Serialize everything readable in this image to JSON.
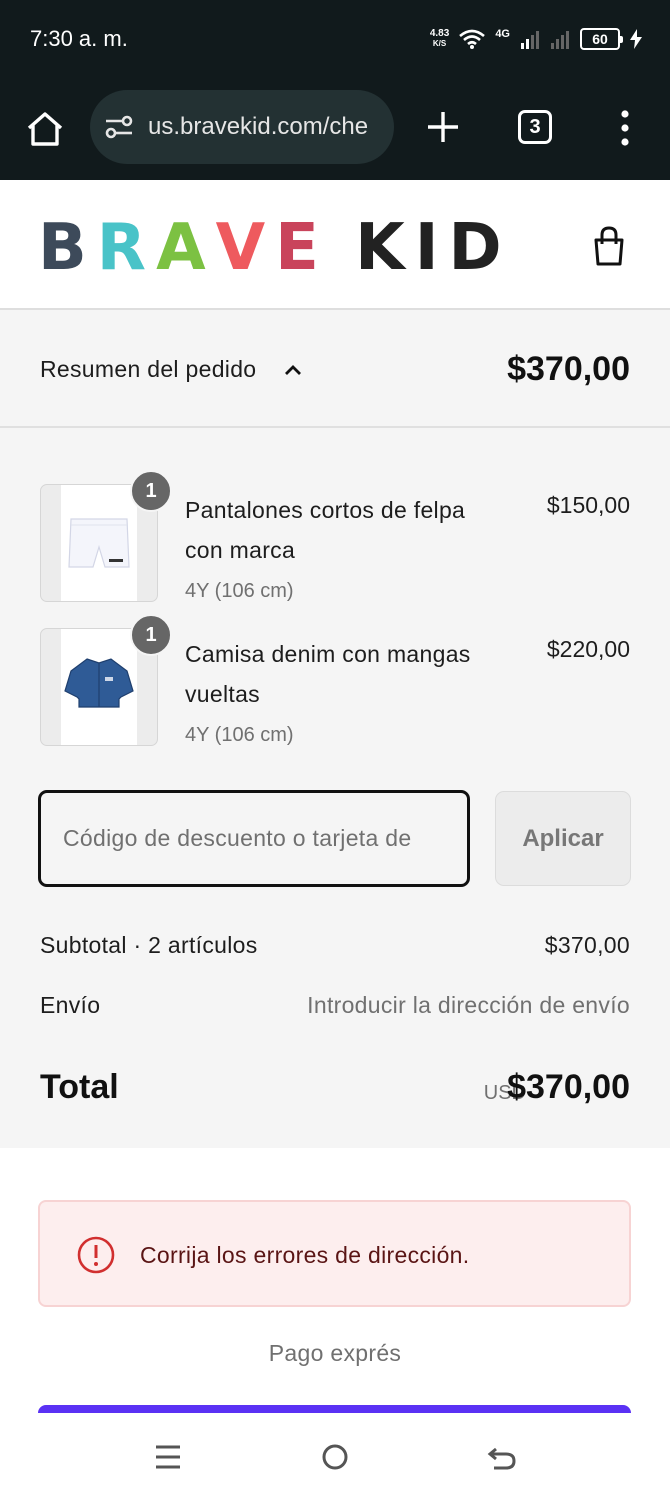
{
  "status_bar": {
    "time": "7:30 a. m.",
    "net_speed": "4.83",
    "net_unit": "K/S",
    "network": "4G",
    "battery": "60"
  },
  "browser": {
    "url": "us.bravekid.com/che",
    "tab_count": "3"
  },
  "header": {
    "logo_letters": [
      {
        "char": "B",
        "color": "#3d4a5a"
      },
      {
        "char": "R",
        "color": "#49c3c8"
      },
      {
        "char": "A",
        "color": "#7cc142"
      },
      {
        "char": "V",
        "color": "#ee5a5e"
      },
      {
        "char": "E",
        "color": "#c9445b"
      },
      {
        "char": " ",
        "color": "#000000"
      },
      {
        "char": "K",
        "color": "#222222"
      },
      {
        "char": "I",
        "color": "#222222"
      },
      {
        "char": "D",
        "color": "#222222"
      }
    ]
  },
  "summary": {
    "label": "Resumen del pedido",
    "total": "$370,00"
  },
  "items": [
    {
      "name": "Pantalones cortos de felpa con marca",
      "variant": "4Y (106 cm)",
      "price": "$150,00",
      "quantity": "1"
    },
    {
      "name": "Camisa denim con mangas vueltas",
      "variant": "4Y (106 cm)",
      "price": "$220,00",
      "quantity": "1"
    }
  ],
  "discount": {
    "placeholder": "Código de descuento o tarjeta de",
    "apply_label": "Aplicar"
  },
  "totals": {
    "subtotal_label": "Subtotal · 2 artículos",
    "subtotal_value": "$370,00",
    "shipping_label": "Envío",
    "shipping_value": "Introducir la dirección de envío",
    "total_label": "Total",
    "currency": "USD",
    "total_value": "$370,00"
  },
  "error": {
    "message": "Corrija los errores de dirección."
  },
  "express": {
    "label": "Pago exprés",
    "button_color": "#5a31f4"
  }
}
